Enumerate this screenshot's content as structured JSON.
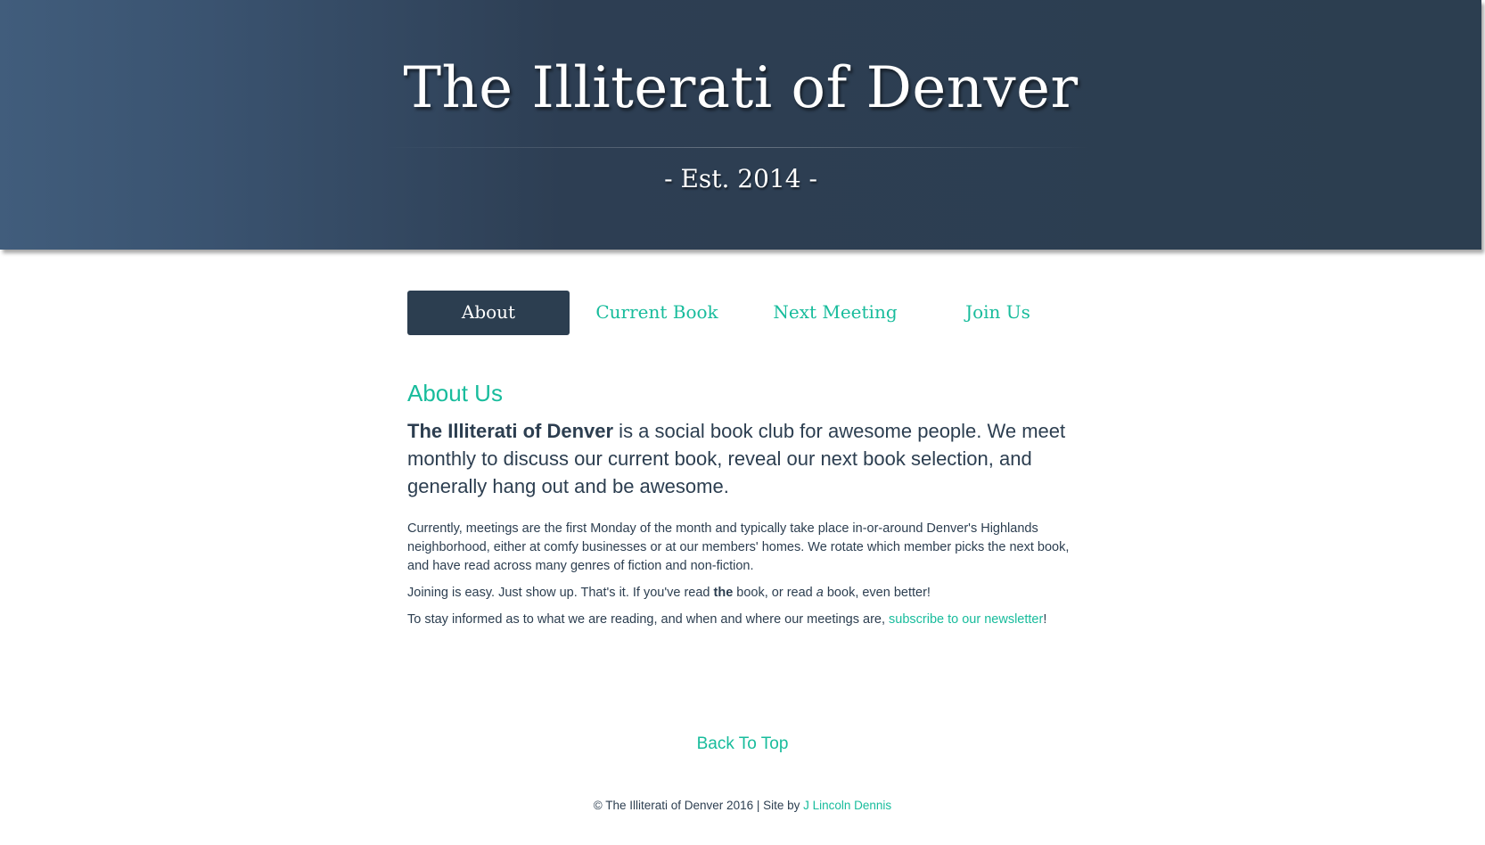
{
  "header": {
    "title": "The Illiterati of Denver",
    "subtitle": "- Est. 2014 -"
  },
  "nav": {
    "items": [
      {
        "label": "About",
        "active": true
      },
      {
        "label": "Current Book",
        "active": false
      },
      {
        "label": "Next Meeting",
        "active": false
      },
      {
        "label": "Join Us",
        "active": false
      }
    ]
  },
  "about": {
    "heading": "About Us",
    "lead_bold": "The Illiterati of Denver",
    "lead_rest": " is a social book club for awesome people. We meet monthly to discuss our current book, reveal our next book selection, and generally hang out and be awesome.",
    "para1": "Currently, meetings are the first Monday of the month and typically take place in-or-around Denver's Highlands neighborhood, either at comfy businesses or at our members' homes. We rotate which member picks the next book, and have read across many genres of fiction and non-fiction.",
    "para2_a": "Joining is easy. Just show up. That's it. If you've read ",
    "para2_bold": "the",
    "para2_b": " book, or read ",
    "para2_italic": "a",
    "para2_c": " book, even better!",
    "para3_text": "To stay informed as to what we are reading, and when and where our meetings are, ",
    "para3_link": "subscribe to our newsletter",
    "para3_end": "!"
  },
  "back_to_top": "Back To Top",
  "footer": {
    "text": "© The Illiterati of Denver 2016 | Site by ",
    "author_link": "J Lincoln Dennis"
  },
  "colors": {
    "accent": "#18bc9c",
    "primary": "#2c3e50",
    "header_gradient_start": "#415d7c"
  }
}
